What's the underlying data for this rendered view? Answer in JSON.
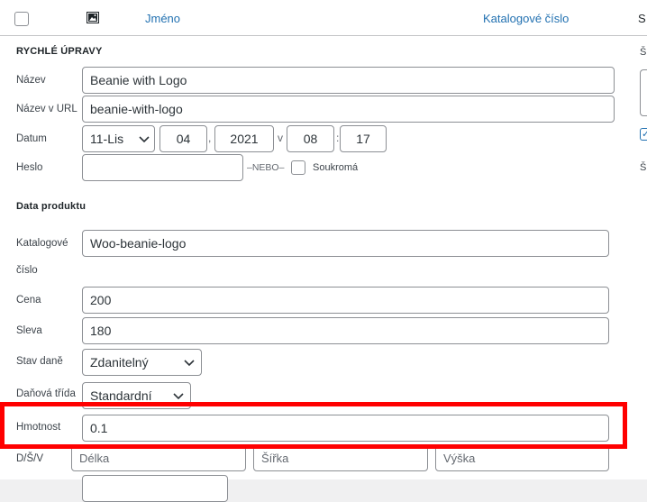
{
  "header": {
    "name_col": "Jméno",
    "sku_col": "Katalogové číslo",
    "next_col_cut": "S"
  },
  "quick_edit": {
    "title": "RYCHLÉ ÚPRAVY",
    "name_label": "Název",
    "name_value": "Beanie with Logo",
    "slug_label": "Název v URL",
    "slug_value": "beanie-with-logo",
    "date_label": "Datum",
    "month_value": "11-Lis",
    "day_value": "04",
    "year_value": "2021",
    "at_sep": "v",
    "hour_value": "08",
    "minute_value": "17",
    "password_label": "Heslo",
    "password_value": "",
    "or_text": "–NEBO–",
    "private_label": "Soukromá"
  },
  "product_data": {
    "title": "Data produktu",
    "sku_label_line1": "Katalogové",
    "sku_label_line2": "číslo",
    "sku_value": "Woo-beanie-logo",
    "price_label": "Cena",
    "price_value": "200",
    "sale_label": "Sleva",
    "sale_value": "180",
    "tax_status_label": "Stav daně",
    "tax_status_value": "Zdanitelný",
    "tax_class_label": "Daňová třída",
    "tax_class_value": "Standardní",
    "weight_label": "Hmotnost",
    "weight_value": "0.1",
    "dims_label": "D/Š/V",
    "length_placeholder": "Délka",
    "width_placeholder": "Šířka",
    "height_placeholder": "Výška"
  },
  "right_column": {
    "label_top": "Š",
    "label_bottom": "Š"
  },
  "colors": {
    "link": "#2271b1",
    "highlight": "#ff0000",
    "border": "#8c8f94"
  }
}
